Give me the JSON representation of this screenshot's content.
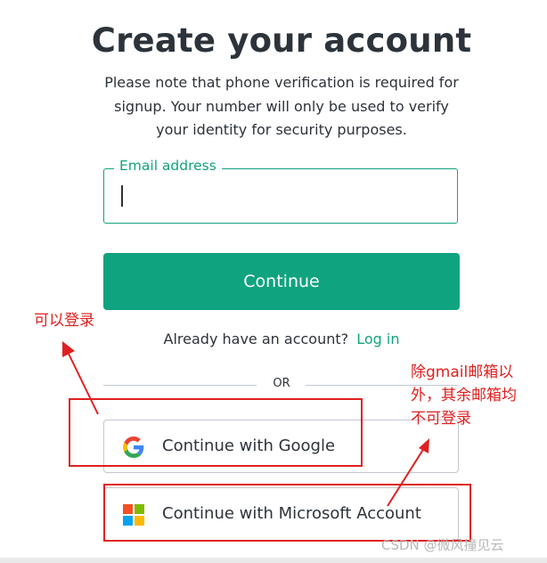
{
  "page": {
    "title": "Create your account",
    "subtitle": "Please note that phone verification is required for signup. Your number will only be used to verify your identity for security purposes."
  },
  "form": {
    "email_label": "Email address",
    "email_value": "",
    "continue_label": "Continue",
    "have_account_text": "Already have an account?",
    "login_link": "Log in",
    "divider_text": "OR"
  },
  "social": {
    "google_label": "Continue with Google",
    "google_icon": "google-logo-icon",
    "microsoft_label": "Continue with Microsoft Account",
    "microsoft_icon": "microsoft-logo-icon"
  },
  "annotations": {
    "left_note": "可以登录",
    "right_note_line1": "除gmail邮箱以",
    "right_note_line2": "外，其余邮箱均",
    "right_note_line3": "不可登录",
    "color": "#e02020"
  },
  "watermark": "CSDN @微风撞见云",
  "colors": {
    "accent": "#10a37f",
    "text": "#2d333a",
    "border": "#c2c8d0"
  }
}
